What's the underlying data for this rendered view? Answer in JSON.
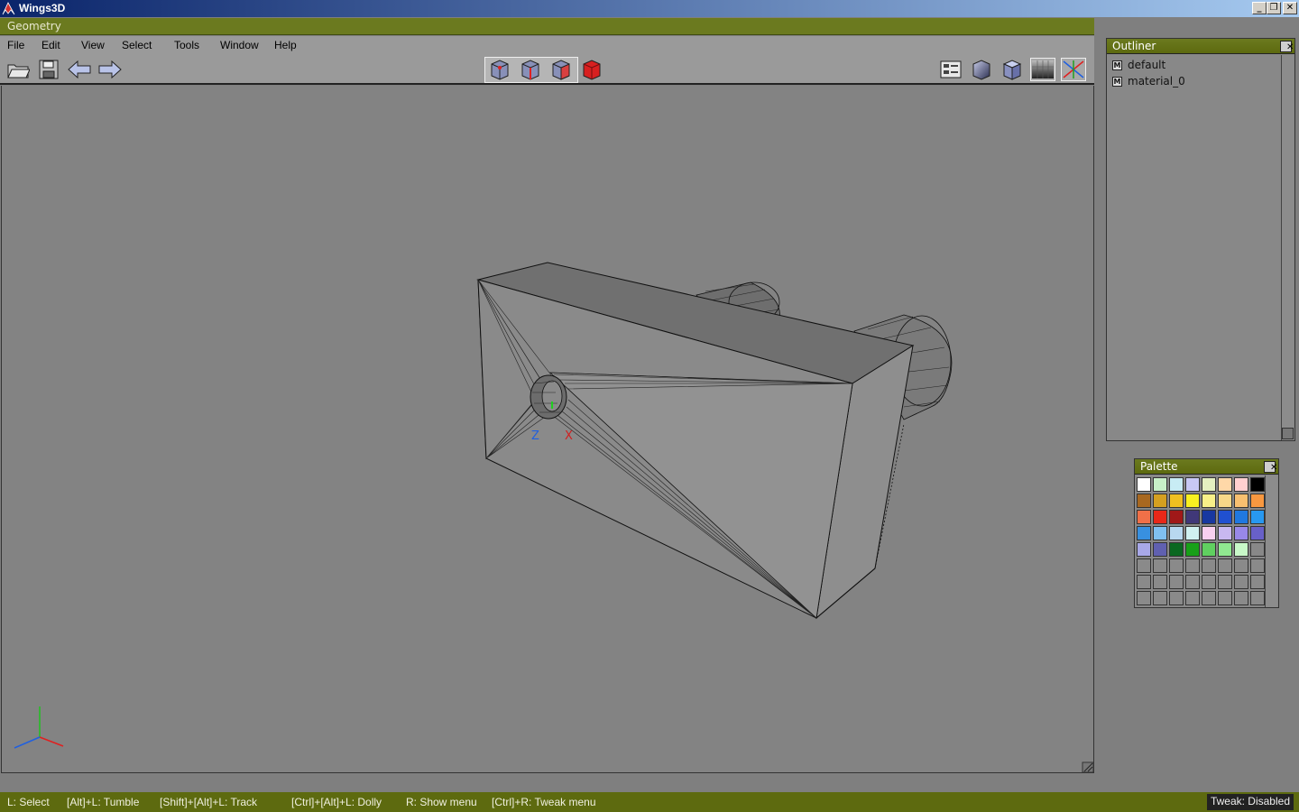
{
  "window": {
    "title": "Wings3D",
    "min_label": "_",
    "max_label": "❐",
    "close_label": "✕"
  },
  "geometry": {
    "title": "Geometry"
  },
  "menu": [
    "File",
    "Edit",
    "View",
    "Select",
    "Tools",
    "Window",
    "Help"
  ],
  "toolbar": {
    "left": [
      "open-icon",
      "save-icon",
      "undo-icon",
      "redo-icon"
    ],
    "select_modes": [
      "vertex-mode-icon",
      "edge-mode-icon",
      "face-mode-icon",
      "body-mode-icon"
    ],
    "right": [
      "view-options-icon",
      "smooth-shade-icon",
      "flat-shade-icon",
      "ground-grid-icon",
      "axes-icon"
    ]
  },
  "viewport": {
    "axis_labels": {
      "z": "Z",
      "x": "X"
    }
  },
  "outliner": {
    "title": "Outliner",
    "items": [
      {
        "icon": "M",
        "label": "default"
      },
      {
        "icon": "M",
        "label": "material_0"
      }
    ]
  },
  "palette": {
    "title": "Palette",
    "colors": [
      "#ffffff",
      "#c8f0c8",
      "#c8ecf4",
      "#c8c8f4",
      "#e4f0c0",
      "#ffd8a8",
      "#ffd0d0",
      "#000000",
      "#a86820",
      "#d4a020",
      "#f0c020",
      "#f8f020",
      "#f8f088",
      "#f8d888",
      "#f8c070",
      "#f89840",
      "#f07048",
      "#e82818",
      "#a01818",
      "#403878",
      "#1838a0",
      "#2050d0",
      "#2078e0",
      "#2898f0",
      "#3890e0",
      "#80c0f0",
      "#b8d8f0",
      "#d0f0f0",
      "#f8d0f0",
      "#c8b8f0",
      "#9888e8",
      "#6860c8",
      "#a8a8e8",
      "#6060b0",
      "#0a6820",
      "#18a018",
      "#60d060",
      "#90e890",
      "#c8f8c8",
      "#888888"
    ]
  },
  "status": {
    "hints": [
      "L: Select",
      "[Alt]+L: Tumble",
      "[Shift]+[Alt]+L: Track",
      "[Ctrl]+[Alt]+L: Dolly",
      "R: Show menu",
      "[Ctrl]+R: Tweak menu"
    ],
    "tweak": "Tweak: Disabled"
  }
}
